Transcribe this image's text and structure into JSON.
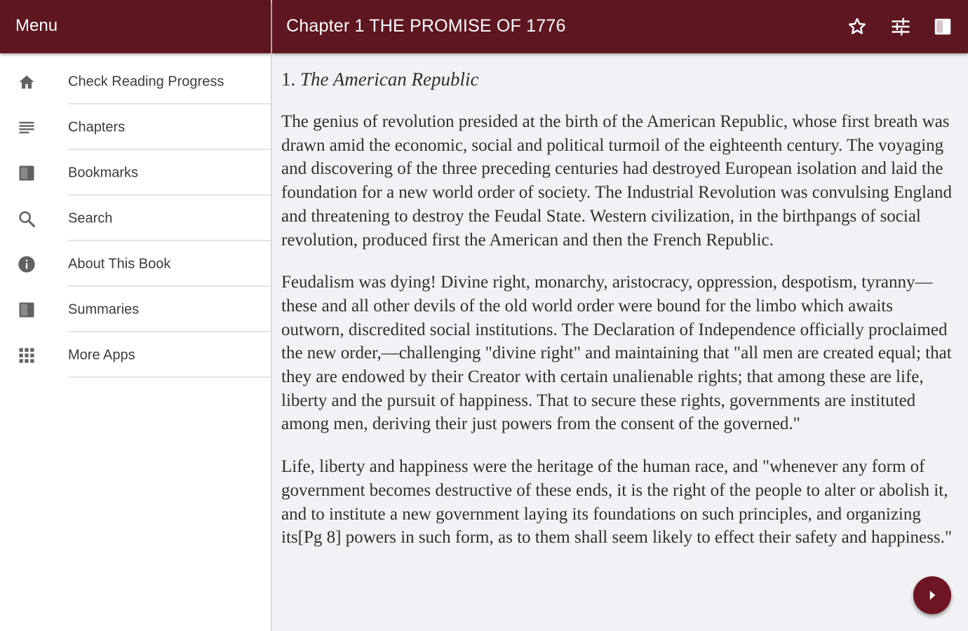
{
  "drawer": {
    "title": "Menu",
    "items": [
      {
        "label": "Check Reading Progress",
        "icon": "home-icon"
      },
      {
        "label": "Chapters",
        "icon": "list-icon"
      },
      {
        "label": "Bookmarks",
        "icon": "book-icon"
      },
      {
        "label": "Search",
        "icon": "search-icon"
      },
      {
        "label": "About This Book",
        "icon": "info-icon"
      },
      {
        "label": "Summaries",
        "icon": "book-icon"
      },
      {
        "label": "More Apps",
        "icon": "grid-icon"
      }
    ]
  },
  "appbar": {
    "chapter_title": "Chapter 1 THE PROMISE OF 1776",
    "actions": [
      "star-icon",
      "settings-sliders-icon",
      "book-toggle-icon"
    ]
  },
  "content": {
    "heading_number": "1.",
    "heading_title": "The American Republic",
    "paragraphs": [
      "The genius of revolution presided at the birth of the American Republic, whose first breath was drawn amid the economic, social and political turmoil of the eighteenth century. The voyaging and discovering of the three preceding centuries had destroyed European isolation and laid the foundation for a new world order of society. The Industrial Revolution was convulsing England and threatening to destroy the Feudal State. Western civilization, in the birthpangs of social revolution, produced first the American and then the French Republic.",
      "Feudalism was dying! Divine right, monarchy, aristocracy, oppression, despotism, tyranny—these and all other devils of the old world order were bound for the limbo which awaits outworn, discredited social institutions. The Declaration of Independence officially proclaimed the new order,—challenging \"divine right\" and maintaining that \"all men are created equal; that they are endowed by their Creator with certain unalienable rights; that among these are life, liberty and the pursuit of happiness. That to secure these rights, governments are instituted among men, deriving their just powers from the consent of the governed.\"",
      "Life, liberty and happiness were the heritage of the human race, and \"whenever any form of government becomes destructive of these ends, it is the right of the people to alter or abolish it, and to institute a new government laying its foundations on such principles, and organizing its[Pg 8] powers in such form, as to them shall seem likely to effect their safety and happiness.\""
    ]
  },
  "fab": {
    "icon": "play-next-icon"
  },
  "colors": {
    "primary": "#5e1620",
    "fab": "#6d1522",
    "reading_background": "#f1f2f6",
    "icon_gray": "#616161"
  }
}
